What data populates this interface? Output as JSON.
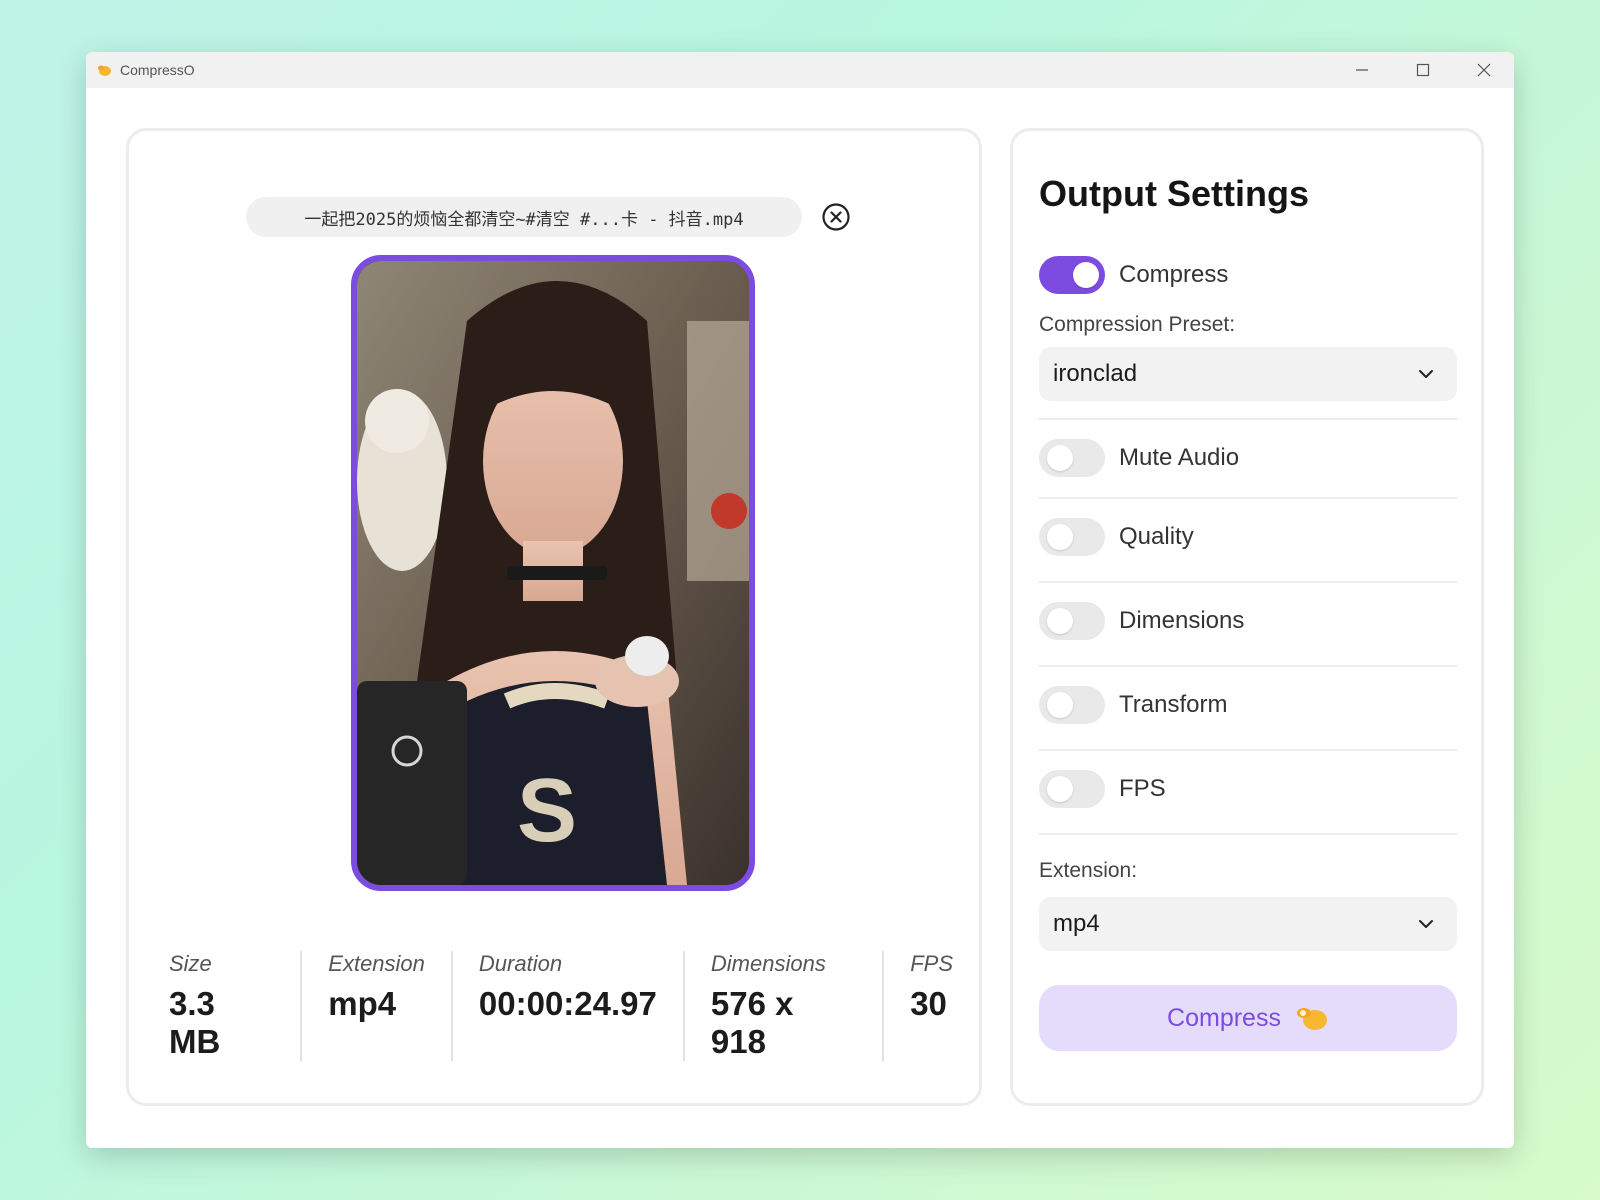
{
  "window": {
    "title": "CompressO",
    "app_icon": "compresso-hand-icon",
    "controls": [
      "minimize-icon",
      "maximize-icon",
      "close-icon"
    ]
  },
  "file": {
    "name": "一起把2025的烦恼全都清空~#清空 #...卡 - 抖音.mp4",
    "remove_icon": "circle-x-icon"
  },
  "metadata": {
    "size": {
      "label": "Size",
      "value": "3.3 MB"
    },
    "extension": {
      "label": "Extension",
      "value": "mp4"
    },
    "duration": {
      "label": "Duration",
      "value": "00:00:24.97"
    },
    "dimensions": {
      "label": "Dimensions",
      "value": "576 x 918"
    },
    "fps": {
      "label": "FPS",
      "value": "30"
    }
  },
  "settings": {
    "title": "Output Settings",
    "compress_toggle": {
      "label": "Compress",
      "on": true
    },
    "preset_label": "Compression Preset:",
    "preset_value": "ironclad",
    "toggles": [
      {
        "label": "Mute Audio",
        "on": false
      },
      {
        "label": "Quality",
        "on": false
      },
      {
        "label": "Dimensions",
        "on": false
      },
      {
        "label": "Transform",
        "on": false
      },
      {
        "label": "FPS",
        "on": false
      }
    ],
    "extension_label": "Extension:",
    "extension_value": "mp4",
    "compress_button": "Compress"
  },
  "colors": {
    "accent": "#7c4ce0",
    "accent_light": "#e4dcfa",
    "toggle_off": "#e9e9e9"
  }
}
